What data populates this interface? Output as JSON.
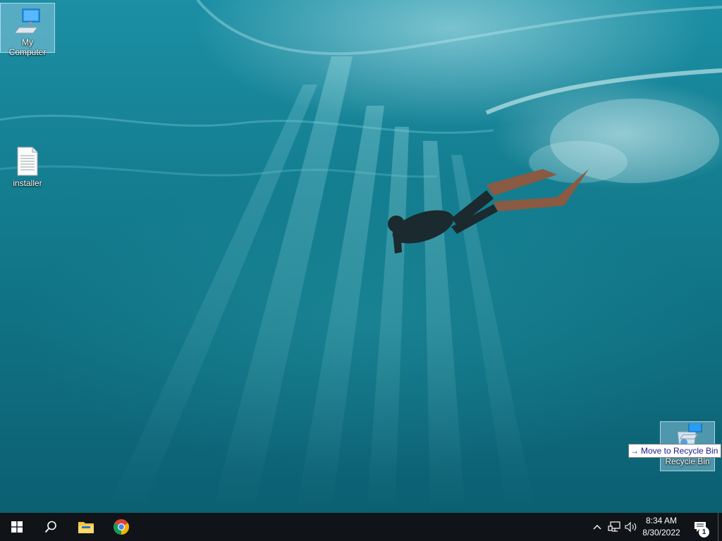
{
  "desktop": {
    "icons": [
      {
        "label": "My Computer",
        "icon": "computer-icon",
        "selected": true
      },
      {
        "label": "installer",
        "icon": "text-file-icon",
        "selected": false
      },
      {
        "label": "Recycle Bin",
        "icon": "recycle-bin-icon",
        "selected": true
      }
    ],
    "drag_tooltip": "Move to Recycle Bin"
  },
  "taskbar": {
    "start": "windows-start-icon",
    "search": "search-icon",
    "pinned": [
      {
        "name": "File Explorer",
        "icon": "file-explorer-icon"
      },
      {
        "name": "Google Chrome",
        "icon": "chrome-icon"
      }
    ],
    "tray": {
      "hidden_icons": "chevron-up-icon",
      "network": "network-icon",
      "volume": "volume-icon",
      "time": "8:34 AM",
      "date": "8/30/2022",
      "notification_count": "1"
    }
  },
  "colors": {
    "taskbar_bg": "#101418",
    "water_top": "#1c8fa4",
    "water_bottom": "#0b5f71"
  }
}
